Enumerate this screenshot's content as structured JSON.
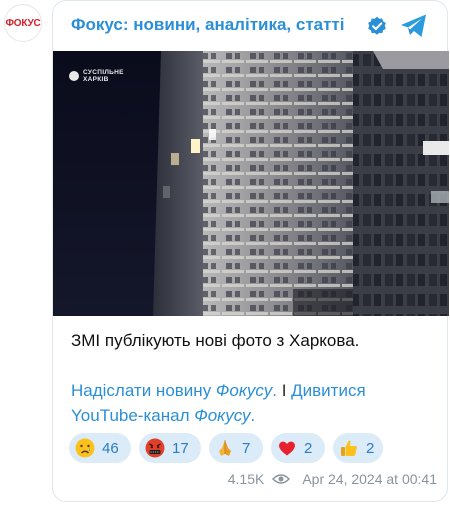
{
  "channel": {
    "avatar_text": "ФОКУС",
    "title": "Фокус: новини, аналітика, статті"
  },
  "photo": {
    "watermark_line1": "СУСПІЛЬНЕ",
    "watermark_line2": "ХАРКІВ"
  },
  "post": {
    "headline": "ЗМІ публікують нові фото з Харкова.",
    "link1_part1": "Надіслати новину ",
    "link1_part2": "Фокусу",
    "link1_part3": ".",
    "separator": " І ",
    "link2_part1": "Дивитися YouTube-канал ",
    "link2_part2": "Фокусу",
    "link2_part3": "."
  },
  "reactions": [
    {
      "icon": "crying-face-icon",
      "count": "46"
    },
    {
      "icon": "cursing-face-icon",
      "count": "17"
    },
    {
      "icon": "praying-hands-icon",
      "count": "7"
    },
    {
      "icon": "red-heart-icon",
      "count": "2"
    },
    {
      "icon": "thumbs-up-icon",
      "count": "2"
    }
  ],
  "meta": {
    "views": "4.15K",
    "timestamp": "Apr 24, 2024 at 00:41"
  },
  "colors": {
    "accent": "#2b8fd6",
    "reaction_bg": "#dcebf8",
    "brand_red": "#d3202a"
  }
}
